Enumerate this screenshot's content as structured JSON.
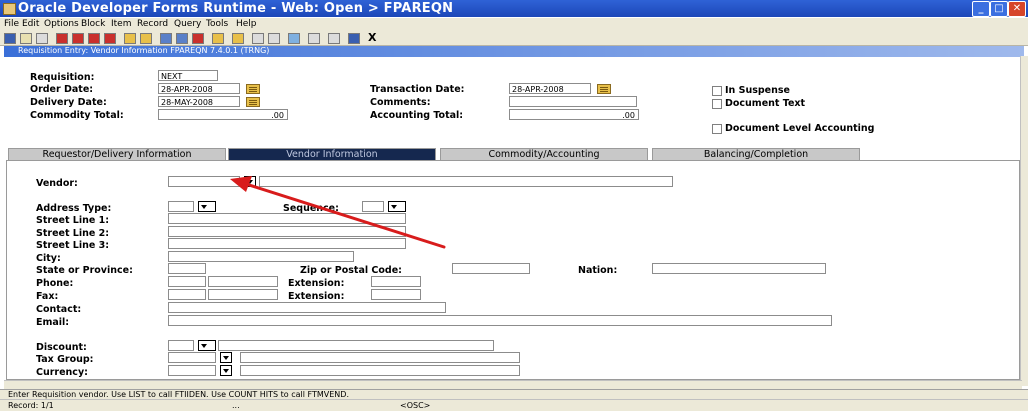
{
  "window": {
    "title": "Oracle Developer Forms Runtime - Web:  Open > FPAREQN",
    "minimize": "_",
    "maximize": "□",
    "close": "✕"
  },
  "menu": [
    "File",
    "Edit",
    "Options",
    "Block",
    "Item",
    "Record",
    "Query",
    "Tools",
    "Help"
  ],
  "toolbar": {
    "exit_label": "X"
  },
  "form_title": "Requisition Entry: Vendor Information  FPAREQN  7.4.0.1  (TRNG)",
  "header": {
    "requisition_label": "Requisition:",
    "requisition_value": "NEXT",
    "order_date_label": "Order Date:",
    "order_date_value": "28-APR-2008",
    "delivery_date_label": "Delivery Date:",
    "delivery_date_value": "28-MAY-2008",
    "commodity_total_label": "Commodity Total:",
    "commodity_total_value": ".00",
    "transaction_date_label": "Transaction Date:",
    "transaction_date_value": "28-APR-2008",
    "comments_label": "Comments:",
    "accounting_total_label": "Accounting Total:",
    "accounting_total_value": ".00",
    "in_suspense_label": "In Suspense",
    "document_text_label": "Document Text",
    "doc_level_accounting_label": "Document Level Accounting"
  },
  "tabs": [
    "Requestor/Delivery Information",
    "Vendor Information",
    "Commodity/Accounting",
    "Balancing/Completion"
  ],
  "vendor": {
    "vendor_label": "Vendor:",
    "address_type_label": "Address Type:",
    "sequence_label": "Sequence:",
    "street1_label": "Street Line 1:",
    "street2_label": "Street Line 2:",
    "street3_label": "Street Line 3:",
    "city_label": "City:",
    "state_label": "State or Province:",
    "zip_label": "Zip or Postal Code:",
    "nation_label": "Nation:",
    "phone_label": "Phone:",
    "phone_ext_label": "Extension:",
    "fax_label": "Fax:",
    "fax_ext_label": "Extension:",
    "contact_label": "Contact:",
    "email_label": "Email:",
    "discount_label": "Discount:",
    "tax_group_label": "Tax Group:",
    "currency_label": "Currency:"
  },
  "status": {
    "message": "Enter Requisition vendor. Use LIST to call FTIIDEN. Use COUNT HITS to call FTMVEND.",
    "record": "Record: 1/1",
    "ellipsis": "...",
    "osc": "<OSC>"
  },
  "colors": {
    "title_bar": "#2f62d6",
    "active_tab": "#15284f",
    "annotation_arrow": "#d81c1c"
  }
}
